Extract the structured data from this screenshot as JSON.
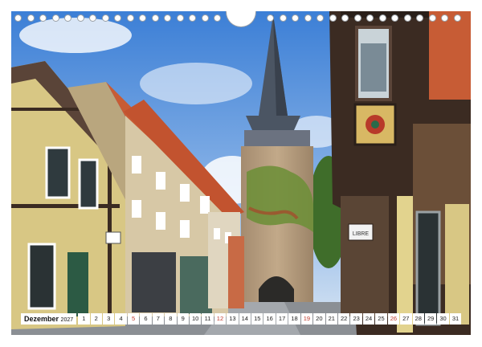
{
  "calendar": {
    "month_label": "Dezember",
    "year_label": "2027",
    "days": [
      "1",
      "2",
      "3",
      "4",
      "5",
      "6",
      "7",
      "8",
      "9",
      "10",
      "11",
      "12",
      "13",
      "14",
      "15",
      "16",
      "17",
      "18",
      "19",
      "20",
      "21",
      "22",
      "23",
      "24",
      "25",
      "26",
      "27",
      "28",
      "29",
      "30",
      "31"
    ],
    "sunday_indices": [
      4,
      11,
      18,
      25
    ]
  },
  "sign": {
    "text": "LIBRE"
  },
  "colors": {
    "sky": "#4a88d9",
    "tower_stone": "#b59b7e",
    "roof_slate": "#4b5563",
    "roof_tile": "#c2532f",
    "ivy": "#6f8f3a",
    "sunday_red": "#c0392b"
  }
}
